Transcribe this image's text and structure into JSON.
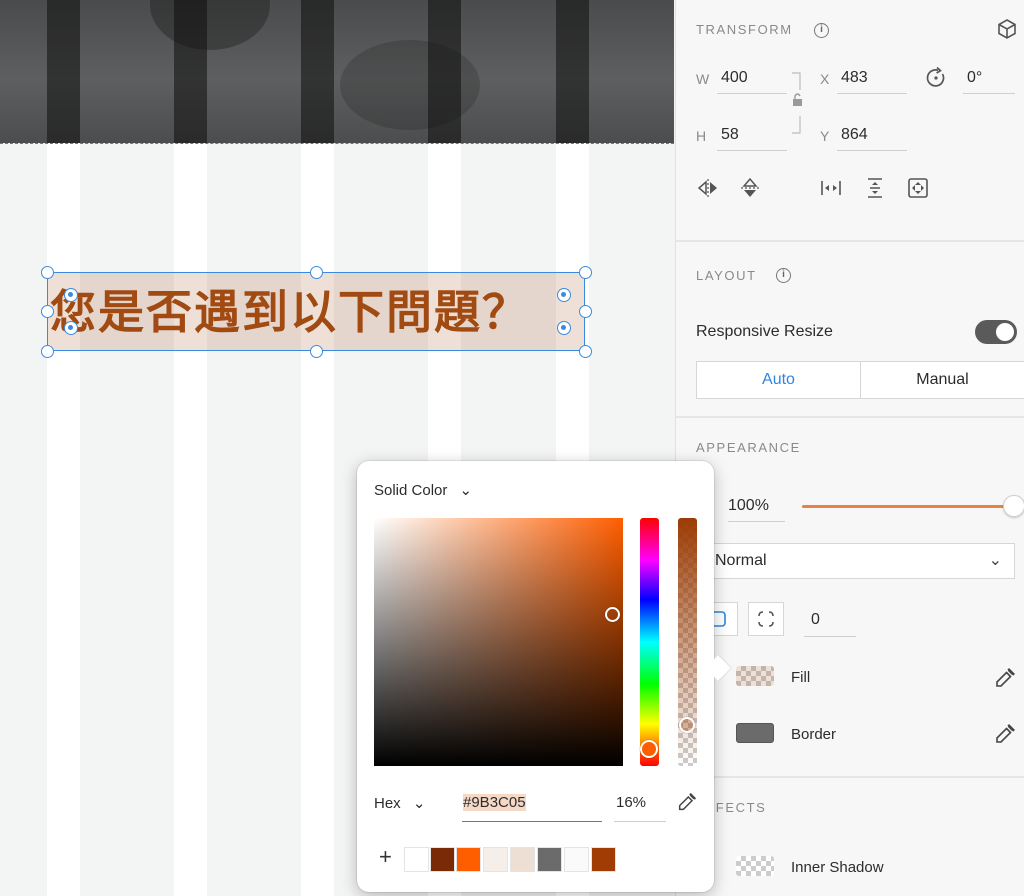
{
  "canvas": {
    "headline": "您是否遇到以下問題？"
  },
  "transform": {
    "title": "TRANSFORM",
    "w_label": "W",
    "w_value": "400",
    "h_label": "H",
    "h_value": "58",
    "x_label": "X",
    "x_value": "483",
    "y_label": "Y",
    "y_value": "864",
    "rotation_value": "0°"
  },
  "layout": {
    "title": "LAYOUT",
    "responsive_label": "Responsive Resize",
    "responsive_on": true,
    "mode_auto": "Auto",
    "mode_manual": "Manual"
  },
  "appearance": {
    "title": "APPEARANCE",
    "opacity": "100%",
    "blend_mode": "Normal",
    "corner_radius": "0",
    "fill_label": "Fill",
    "border_label": "Border",
    "border_color": "#6b6b6b"
  },
  "effects": {
    "title": "EFFECTS",
    "inner_shadow_label": "Inner Shadow"
  },
  "picker": {
    "mode": "Solid Color",
    "hex_mode": "Hex",
    "hex_value": "#9B3C05",
    "alpha_value": "16%",
    "add_icon": "+",
    "document_swatches": [
      "#ffffff",
      "#7a2a06",
      "#ff5e00",
      "#f6eee9",
      "#eedfd5",
      "#6b6b6b",
      "#fafafa",
      "#a13c05"
    ]
  },
  "colors": {
    "accent": "#2e86de",
    "selection": "#3a8be0",
    "slider": "#e8823d",
    "fill_color": "#9B3C05"
  }
}
